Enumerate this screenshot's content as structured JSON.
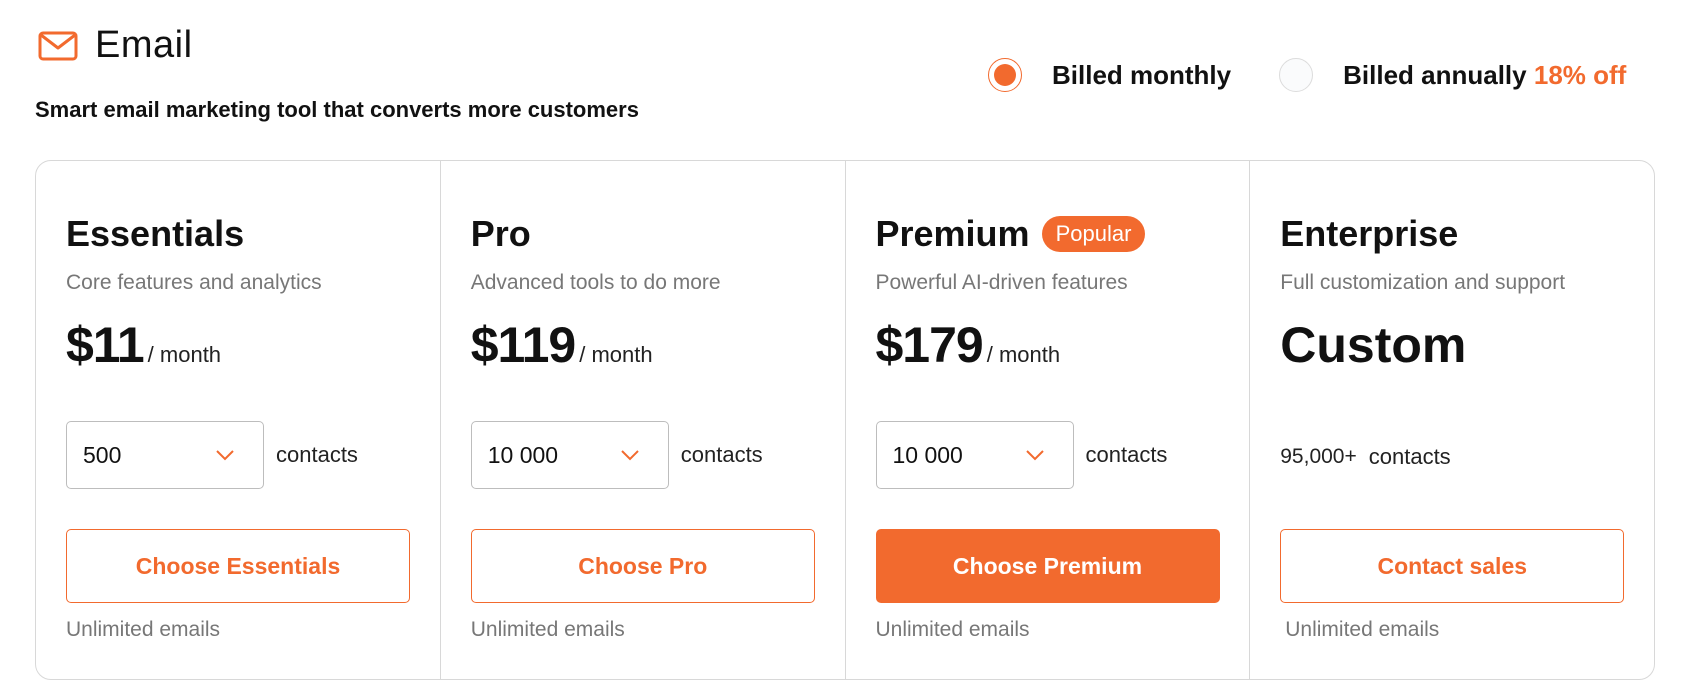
{
  "header": {
    "icon": "mail-icon",
    "title": "Email",
    "subtitle": "Smart email marketing tool that converts more customers"
  },
  "billing": {
    "options": [
      {
        "label": "Billed monthly",
        "selected": true
      },
      {
        "label": "Billed annually",
        "selected": false,
        "discount": "18% off"
      }
    ]
  },
  "colors": {
    "accent": "#f26a2e",
    "border": "#d8d8d8",
    "muted_text": "#777777"
  },
  "plans": [
    {
      "name": "Essentials",
      "description": "Core features and analytics",
      "price": "$11",
      "period": "/ month",
      "contacts_value": "500",
      "contacts_label": "contacts",
      "cta": "Choose Essentials",
      "feature": "Unlimited emails"
    },
    {
      "name": "Pro",
      "description": "Advanced tools to do more",
      "price": "$119",
      "period": "/ month",
      "contacts_value": "10 000",
      "contacts_label": "contacts",
      "cta": "Choose Pro",
      "feature": "Unlimited emails"
    },
    {
      "name": "Premium",
      "badge": "Popular",
      "description": "Powerful AI-driven features",
      "price": "$179",
      "period": "/ month",
      "contacts_value": "10 000",
      "contacts_label": "contacts",
      "cta": "Choose Premium",
      "feature": "Unlimited emails"
    },
    {
      "name": "Enterprise",
      "description": "Full customization and support",
      "price": "Custom",
      "contacts_value": "95,000+",
      "contacts_label": "contacts",
      "cta": "Contact sales",
      "feature": "Unlimited emails"
    }
  ]
}
